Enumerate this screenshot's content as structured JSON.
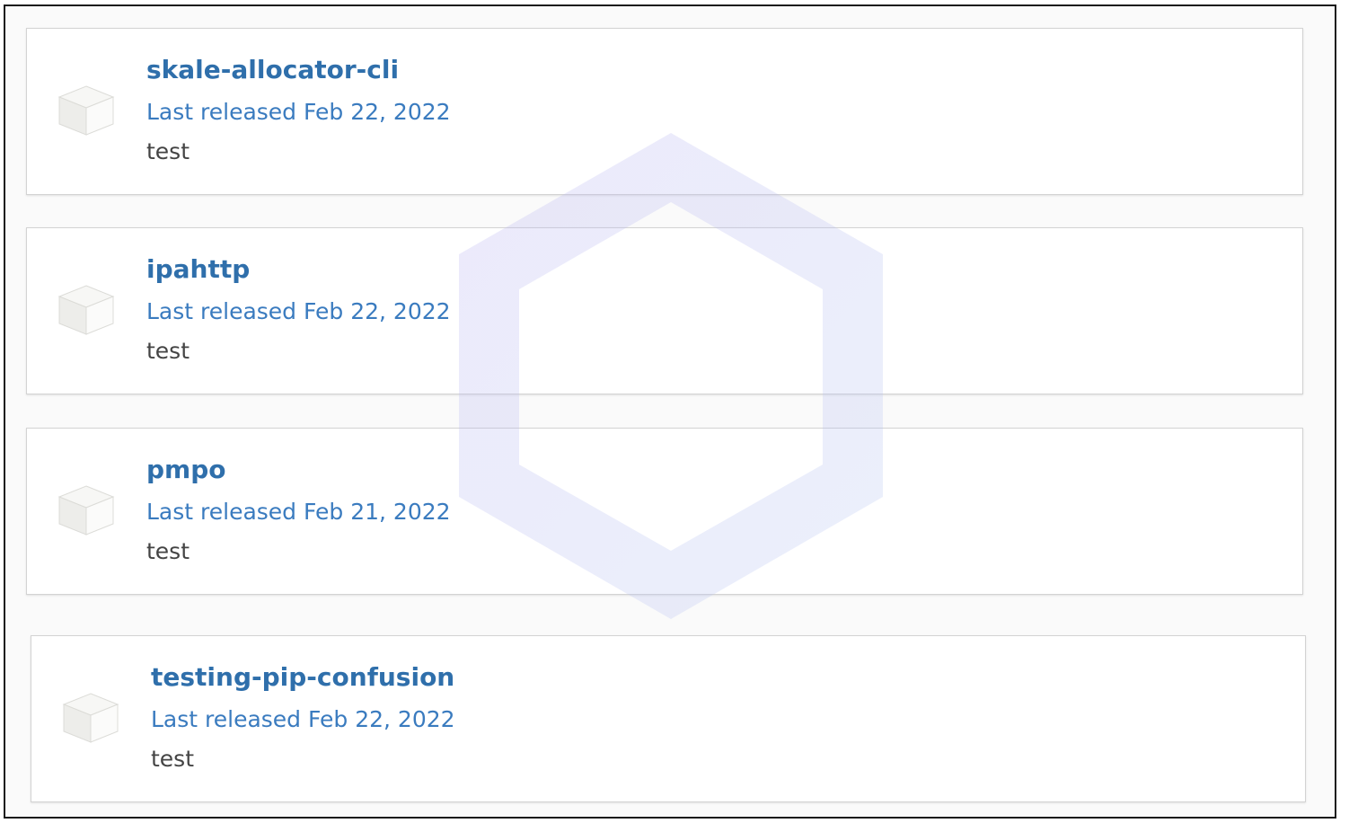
{
  "packages": [
    {
      "name": "skale-allocator-cli",
      "released": "Last released Feb 22, 2022",
      "description": "test",
      "icon": "package-box-icon"
    },
    {
      "name": "ipahttp",
      "released": "Last released Feb 22, 2022",
      "description": "test",
      "icon": "package-box-icon"
    },
    {
      "name": "pmpo",
      "released": "Last released Feb 21, 2022",
      "description": "test",
      "icon": "package-box-icon"
    },
    {
      "name": "testing-pip-confusion",
      "released": "Last released Feb 22, 2022",
      "description": "test",
      "icon": "package-box-icon"
    }
  ],
  "watermark": {
    "icon": "hexagon-logo-icon",
    "color": "#c8c8f5"
  },
  "colors": {
    "link": "#2f6fab",
    "released": "#3a7bbf",
    "text": "#444444",
    "border": "#d3d3d3"
  }
}
